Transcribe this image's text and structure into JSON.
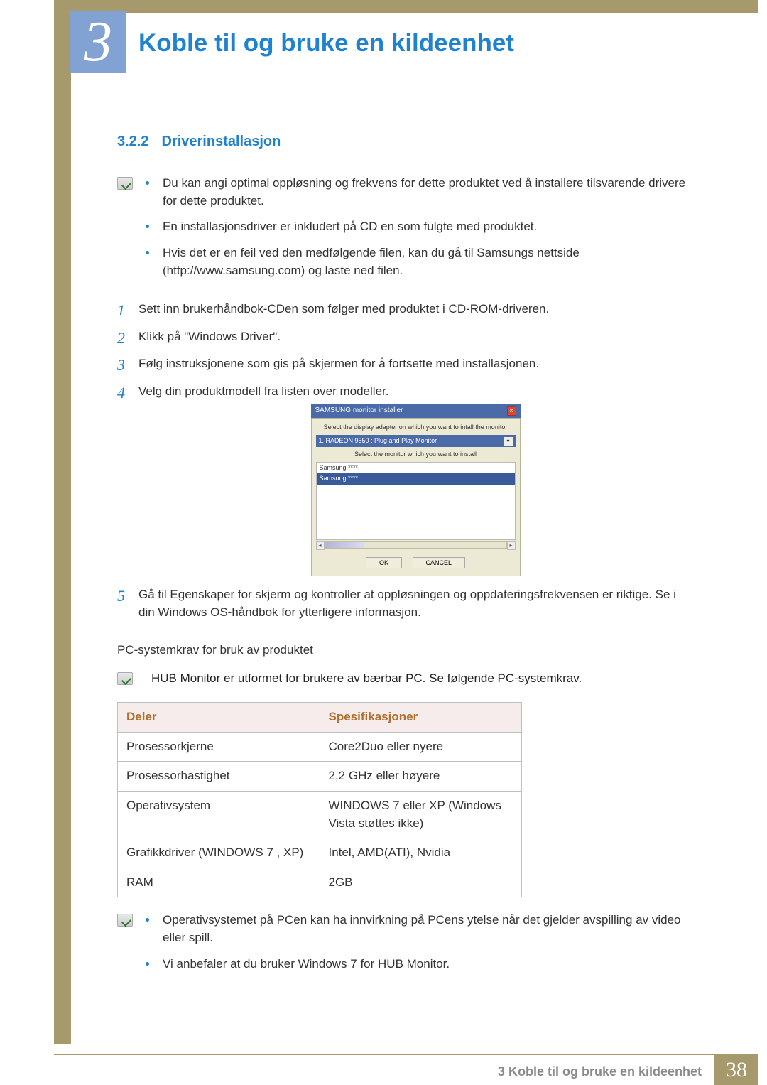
{
  "chapter": {
    "number": "3",
    "title": "Koble til og bruke en kildeenhet"
  },
  "section": {
    "number": "3.2.2",
    "title": "Driverinstallasjon"
  },
  "intro_bullets": [
    "Du kan angi optimal oppløsning og frekvens for dette produktet ved å installere tilsvarende drivere for dette produktet.",
    "En installasjonsdriver er inkludert på CD en som fulgte med produktet.",
    "Hvis det er en feil ved den medfølgende filen, kan du gå til Samsungs nettside (http://www.samsung.com) og laste ned filen."
  ],
  "steps": [
    "Sett inn brukerhåndbok-CDen som følger med produktet i CD-ROM-driveren.",
    "Klikk på \"Windows Driver\".",
    "Følg instruksjonene som gis på skjermen for å fortsette med installasjonen.",
    "Velg din produktmodell fra listen over modeller.",
    "Gå til Egenskaper for skjerm og kontroller at oppløsningen og oppdateringsfrekvensen er riktige. Se i din Windows OS-håndbok for ytterligere informasjon."
  ],
  "installer": {
    "window_title": "SAMSUNG monitor installer",
    "caption1": "Select the display adapter on which you want to intall the monitor",
    "dropdown": "1. RADEON 9550 : Plug and Play Monitor",
    "caption2": "Select the monitor which you want to install",
    "list": [
      "Samsung ****",
      "Samsung ****"
    ],
    "ok": "OK",
    "cancel": "CANCEL"
  },
  "pc_req_heading": "PC-systemkrav for bruk av produktet",
  "pc_req_note": "HUB Monitor er utformet for brukere av bærbar PC. Se følgende PC-systemkrav.",
  "table": {
    "headers": [
      "Deler",
      "Spesifikasjoner"
    ],
    "rows": [
      [
        "Prosessorkjerne",
        "Core2Duo eller nyere"
      ],
      [
        "Prosessorhastighet",
        "2,2 GHz eller høyere"
      ],
      [
        "Operativsystem",
        "WINDOWS 7 eller XP (Windows Vista støttes ikke)"
      ],
      [
        "Grafikkdriver (WINDOWS 7 , XP)",
        "Intel, AMD(ATI), Nvidia"
      ],
      [
        "RAM",
        "2GB"
      ]
    ]
  },
  "closing_bullets": [
    "Operativsystemet på PCen kan ha innvirkning på PCens ytelse når det gjelder avspilling av video eller spill.",
    "Vi anbefaler at du bruker Windows 7 for HUB Monitor."
  ],
  "footer": {
    "text_prefix": "3",
    "text": "Koble til og bruke en kildeenhet",
    "page": "38"
  }
}
